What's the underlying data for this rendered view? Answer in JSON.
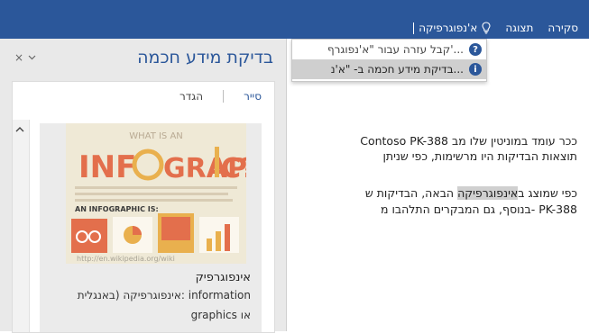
{
  "ribbon": {
    "tabs": [
      {
        "label": "סקירה"
      },
      {
        "label": "תצוגה"
      }
    ],
    "tell_me": {
      "value": "א'נפוגרפיקה"
    }
  },
  "dropdown": {
    "items": [
      {
        "label": "קבל עזרה עבור \"א'נפוגרף'...",
        "icon": "help-icon"
      },
      {
        "label": "בדיקת מידע חכמה ב- \"א'נ...",
        "icon": "smart-lookup-icon"
      }
    ]
  },
  "pane": {
    "title": "בדיקת מידע חכמה",
    "close": "×",
    "tabs": [
      {
        "label": "סייר",
        "active": true
      },
      {
        "label": "הגדר",
        "active": false
      }
    ],
    "card": {
      "image_text": {
        "top": "WHAT IS AN",
        "big_left": "INF",
        "big_right": "GRAPH",
        "big_end": "C?",
        "section": "AN INFOGRAPHIC IS:",
        "source": "http://en.wikipedia.org/wiki"
      },
      "title": "אינפוגרפיק",
      "text_line1": "אינפוגרפיקה (באנגלית: information",
      "text_line2": "graphics או"
    }
  },
  "document": {
    "lines": [
      {
        "pre": "Contoso PK-388 ככר עומד במוניטין שלו מב",
        "hl": "",
        "post": ""
      },
      {
        "pre": "תוצאות הבדיקות היו מרשימות, כפי שניתן",
        "hl": "",
        "post": ""
      },
      {
        "pre": "כפי שמוצג ב",
        "hl": "אינפוגרפיקה",
        "post": " הבאה, הבדיקות ש"
      },
      {
        "pre": "בנוסף, גם המבקרים התלהבו מ- PK-388",
        "hl": "",
        "post": ""
      }
    ]
  },
  "colors": {
    "ribbon": "#2b579a",
    "pane_bg": "#e9e9e9",
    "accent_text": "#2b579a",
    "selection": "#cfcfcf"
  }
}
